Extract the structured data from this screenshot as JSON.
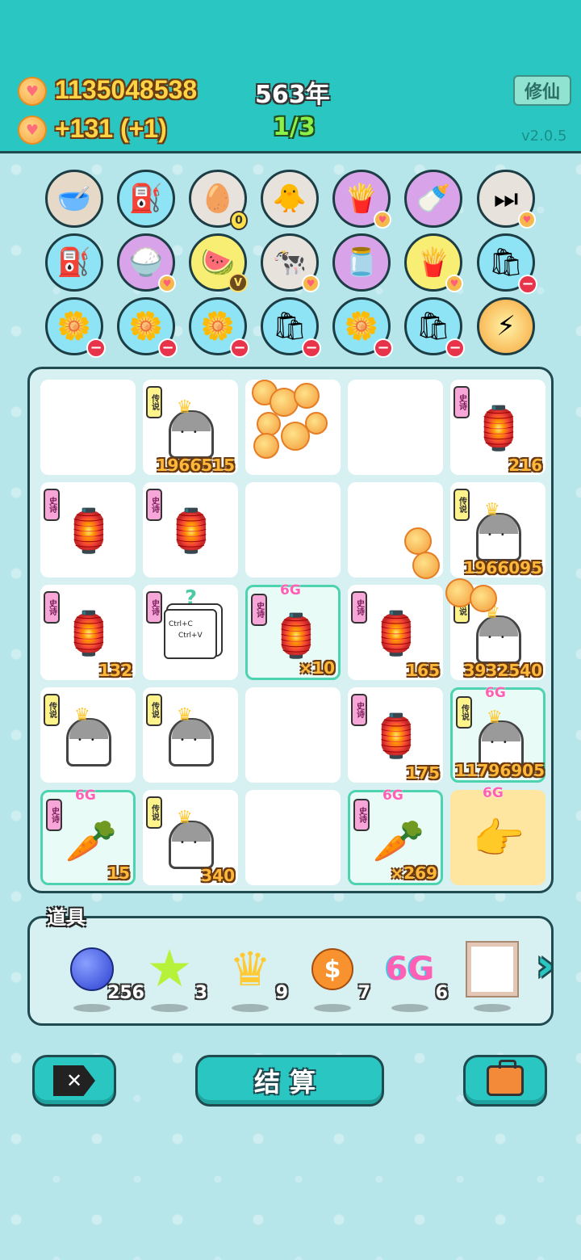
{
  "header": {
    "coins": "1135048538",
    "income": "+131 (+1)",
    "year": "563年",
    "progress": "1/3",
    "xiuxian_label": "修仙",
    "version": "v2.0.5",
    "coin_icon": "heart-coin-icon"
  },
  "tools": [
    {
      "icon": "dog-bowl-icon",
      "glyph": "🥣"
    },
    {
      "icon": "pump-icon",
      "glyph": "⛽"
    },
    {
      "icon": "egg-tray-icon",
      "glyph": "🥚",
      "badge_num": "0"
    },
    {
      "icon": "chick-icon",
      "glyph": "🐥"
    },
    {
      "icon": "fries-icon",
      "glyph": "🍟"
    },
    {
      "icon": "baby-bottle-icon",
      "glyph": "🍼"
    },
    {
      "icon": "skip-icon",
      "glyph": "⏭"
    },
    {
      "icon": "pump-icon",
      "glyph": "⛽"
    },
    {
      "icon": "rice-bowl-icon",
      "glyph": "🍚"
    },
    {
      "icon": "fruit-basket-icon",
      "glyph": "🍉"
    },
    {
      "icon": "cows-icon",
      "glyph": "🐄"
    },
    {
      "icon": "jar-icon",
      "glyph": "🫙"
    },
    {
      "icon": "fries-icon",
      "glyph": "🍟"
    },
    {
      "icon": "feed-sack-icon",
      "glyph": "🛍"
    },
    {
      "icon": "flower-pot-icon",
      "glyph": "🌼"
    },
    {
      "icon": "flower-pot-icon",
      "glyph": "🌼"
    },
    {
      "icon": "flower-pot-icon",
      "glyph": "🌼"
    },
    {
      "icon": "feed-sack-icon",
      "glyph": "🛍"
    },
    {
      "icon": "flower-pot-icon",
      "glyph": "🌼"
    },
    {
      "icon": "feed-sack-icon",
      "glyph": "🛍"
    },
    {
      "icon": "lightning-icon",
      "glyph": "⚡"
    }
  ],
  "tags": {
    "legend": "传说",
    "epic": "史诗"
  },
  "grid": {
    "r0c1": "1966515",
    "r0c4": "216",
    "r1c4": "1966095",
    "r2c0": "132",
    "r2c2": "×10",
    "r2c3": "165",
    "r2c4": "3932540",
    "r3c3": "175",
    "r3c4": "11796905",
    "r4c0": "15",
    "r4c1": "340",
    "r4c3": "×269",
    "copy_text_1": "Ctrl+C",
    "copy_text_2": "Ctrl+V",
    "question": "?",
    "badge_6g": "6G"
  },
  "items": {
    "title": "道具",
    "list": [
      {
        "icon": "blue-orb-icon",
        "count": "256"
      },
      {
        "icon": "star-icon",
        "count": "3"
      },
      {
        "icon": "crown-icon",
        "count": "9"
      },
      {
        "icon": "dollar-coin-icon",
        "count": "7"
      },
      {
        "icon": "6g-icon",
        "count": "6",
        "label": "6G"
      },
      {
        "icon": "husky-portrait-icon",
        "count": ""
      }
    ]
  },
  "buttons": {
    "settle": "结算"
  },
  "colors": {
    "header": "#2ac7c2",
    "background": "#b7e6ea",
    "coin_text": "#ffd545",
    "progress_text": "#8bf04a"
  }
}
